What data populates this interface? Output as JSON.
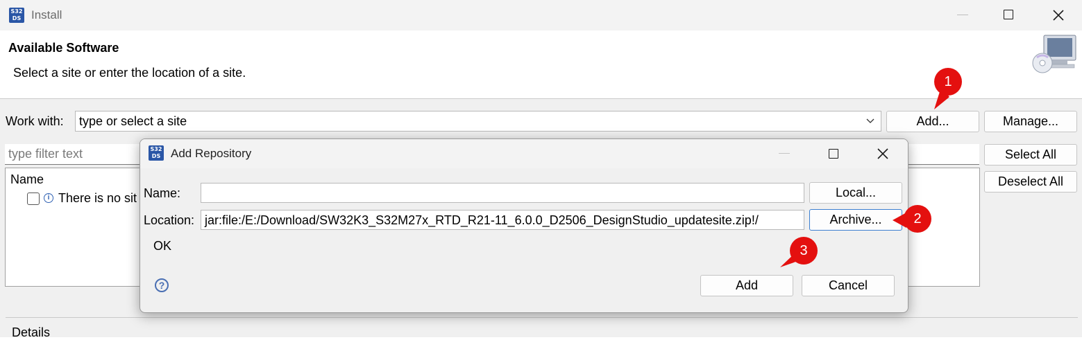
{
  "window": {
    "app_icon_text_top": "S32",
    "app_icon_text_bottom": "DS",
    "title": "Install",
    "minimize_icon": "minimize-icon",
    "maximize_icon": "maximize-icon",
    "close_icon": "close-icon"
  },
  "header": {
    "title": "Available Software",
    "subtitle": "Select a site or enter the location of a site.",
    "banner_icon": "install-software-icon"
  },
  "work_with": {
    "label": "Work with:",
    "value": "type or select a site",
    "dropdown_icon": "chevron-down-icon",
    "add_button": "Add...",
    "manage_button": "Manage..."
  },
  "filter": {
    "placeholder": "type filter text"
  },
  "side_buttons": {
    "select_all": "Select All",
    "deselect_all": "Deselect All"
  },
  "software_list": {
    "column_name": "Name",
    "row_text": "There is no sit",
    "row_icon": "info-icon"
  },
  "details": {
    "label": "Details"
  },
  "dialog": {
    "title": "Add Repository",
    "name_label": "Name:",
    "name_value": "",
    "location_label": "Location:",
    "location_value": "jar:file:/E:/Download/SW32K3_S32M27x_RTD_R21-11_6.0.0_D2506_DesignStudio_updatesite.zip!/",
    "local_button": "Local...",
    "archive_button": "Archive...",
    "status": "OK",
    "help_icon": "help-icon",
    "add_button": "Add",
    "cancel_button": "Cancel"
  },
  "callouts": [
    {
      "number": "1"
    },
    {
      "number": "2"
    },
    {
      "number": "3"
    }
  ],
  "colors": {
    "callout": "#e4100f",
    "accent_border": "#3c7fd1",
    "dialog_background": "#f0f0f0"
  }
}
